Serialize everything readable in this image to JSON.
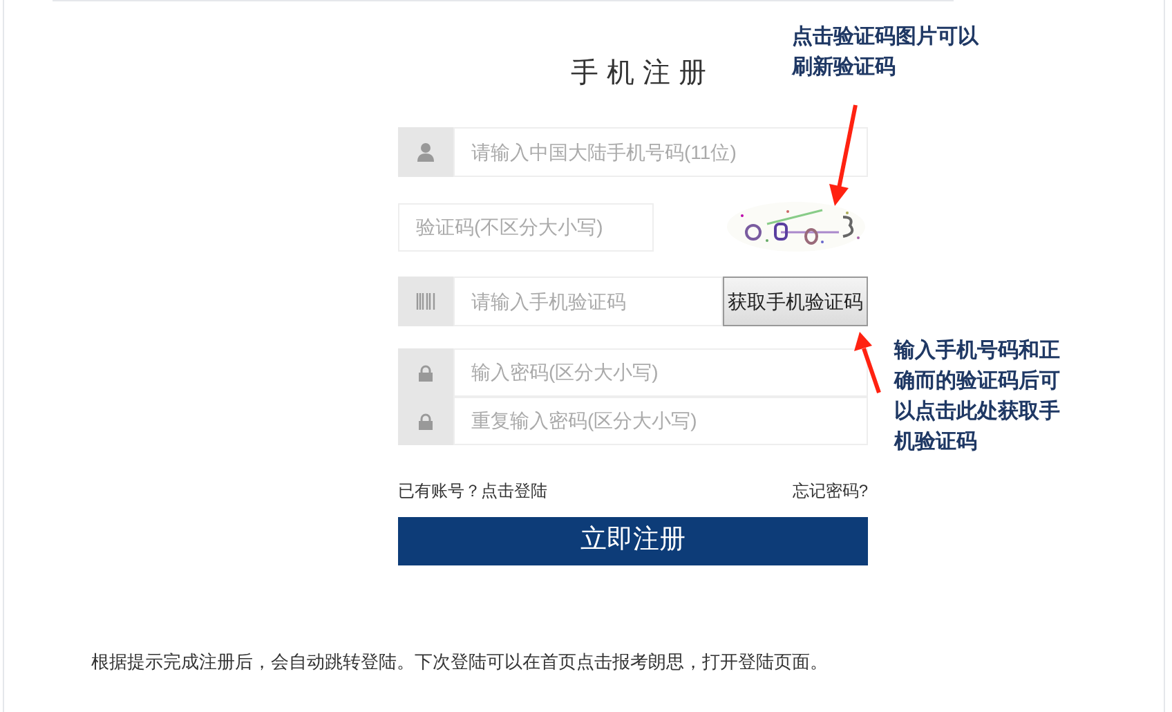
{
  "title": "手机注册",
  "phone_field": {
    "placeholder": "请输入中国大陆手机号码(11位)"
  },
  "captcha_field": {
    "placeholder": "验证码(不区分大小写)"
  },
  "sms_field": {
    "placeholder": "请输入手机验证码"
  },
  "sms_button": "获取手机验证码",
  "password_fields": [
    {
      "placeholder": "输入密码(区分大小写)"
    },
    {
      "placeholder": "重复输入密码(区分大小写)"
    }
  ],
  "login_link": "已有账号？点击登陆",
  "forgot_link": "忘记密码?",
  "submit_button": "立即注册",
  "note": "根据提示完成注册后，会自动跳转登陆。下次登陆可以在首页点击报考朗思，打开登陆页面。",
  "annotations": [
    {
      "text": "点击验证码图片可以刷新验证码"
    },
    {
      "text": "输入手机号码和正确而的验证码后可以点击此处获取手机验证码"
    }
  ]
}
